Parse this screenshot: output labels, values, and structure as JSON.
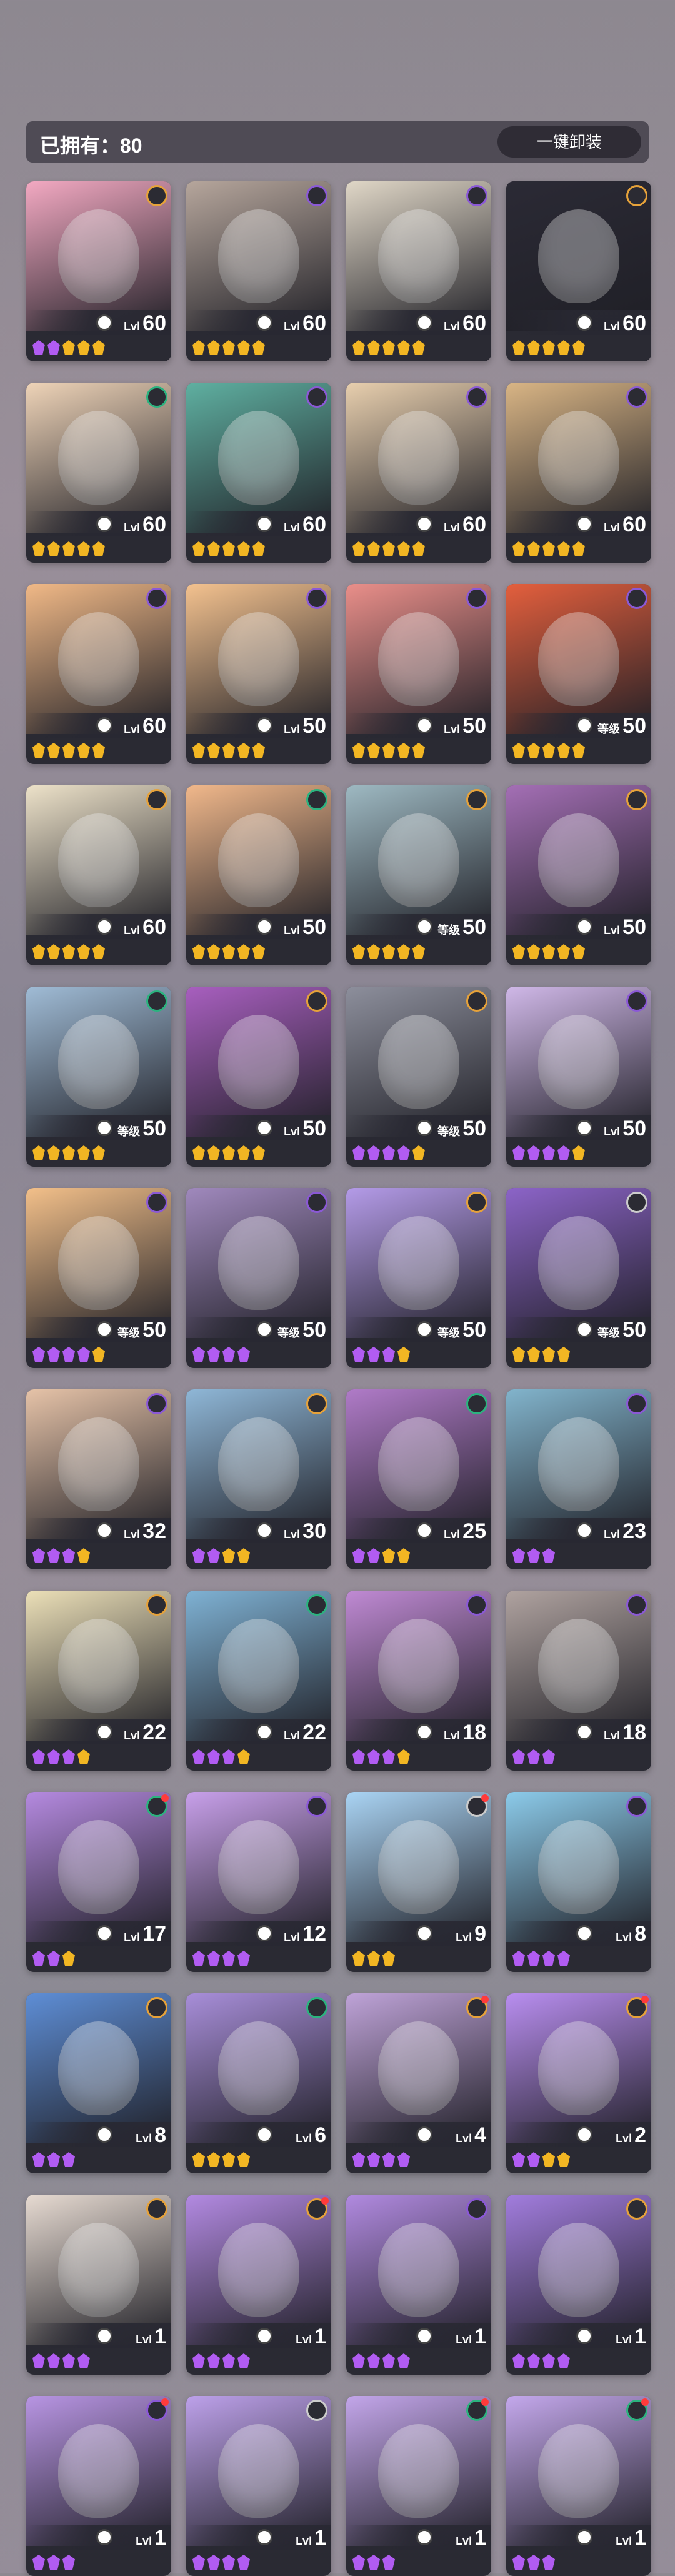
{
  "header": {
    "owned_label": "已拥有：80",
    "unequip_all_label": "一键卸装"
  },
  "colors": {
    "gold": "#f2b623",
    "purple": "#b15cf2",
    "faction_orange": "#e6a23a",
    "faction_purple": "#8b59d6",
    "faction_green": "#2bb37f",
    "faction_white": "#cccccc"
  },
  "cards": [
    {
      "level": "60",
      "level_label": "Lvl",
      "gems": "ppggg",
      "faction": "orange",
      "bg": "#f3a9c2"
    },
    {
      "level": "60",
      "level_label": "Lvl",
      "gems": "ggggg",
      "faction": "purple",
      "bg": "#b6a69c"
    },
    {
      "level": "60",
      "level_label": "Lvl",
      "gems": "ggggg",
      "faction": "purple",
      "bg": "#e0d7c7"
    },
    {
      "level": "60",
      "level_label": "Lvl",
      "gems": "ggggg",
      "faction": "orange",
      "bg": "#2b2a35"
    },
    {
      "level": "60",
      "level_label": "Lvl",
      "gems": "ggggg",
      "faction": "green",
      "bg": "#efd4b8"
    },
    {
      "level": "60",
      "level_label": "Lvl",
      "gems": "ggggg",
      "faction": "purple",
      "bg": "#5fb0a1"
    },
    {
      "level": "60",
      "level_label": "Lvl",
      "gems": "ggggg",
      "faction": "purple",
      "bg": "#e8cfae"
    },
    {
      "level": "60",
      "level_label": "Lvl",
      "gems": "ggggg",
      "faction": "purple",
      "bg": "#d9b585"
    },
    {
      "level": "60",
      "level_label": "Lvl",
      "gems": "ggggg",
      "faction": "purple",
      "bg": "#f1b987"
    },
    {
      "level": "50",
      "level_label": "Lvl",
      "gems": "ggggg",
      "faction": "purple",
      "bg": "#f4c28f"
    },
    {
      "level": "50",
      "level_label": "Lvl",
      "gems": "ggggg",
      "faction": "purple",
      "bg": "#ea8f8a"
    },
    {
      "level": "50",
      "level_label": "等级",
      "gems": "ggggg",
      "faction": "purple",
      "bg": "#e45f3d"
    },
    {
      "level": "60",
      "level_label": "Lvl",
      "gems": "ggggg",
      "faction": "orange",
      "bg": "#ede2c9"
    },
    {
      "level": "50",
      "level_label": "Lvl",
      "gems": "ggggg",
      "faction": "green",
      "bg": "#f1b88b"
    },
    {
      "level": "50",
      "level_label": "等级",
      "gems": "ggggg",
      "faction": "orange",
      "bg": "#9eb9c2"
    },
    {
      "level": "50",
      "level_label": "Lvl",
      "gems": "ggggg",
      "faction": "orange",
      "bg": "#a46fb5"
    },
    {
      "level": "50",
      "level_label": "等级",
      "gems": "ggggg",
      "faction": "green",
      "bg": "#a0bcd6"
    },
    {
      "level": "50",
      "level_label": "Lvl",
      "gems": "ggggg",
      "faction": "orange",
      "bg": "#a85fbf"
    },
    {
      "level": "50",
      "level_label": "等级",
      "gems": "ppppg",
      "faction": "orange",
      "bg": "#8d8f9c"
    },
    {
      "level": "50",
      "level_label": "Lvl",
      "gems": "ppppg",
      "faction": "purple",
      "bg": "#d0b8e8"
    },
    {
      "level": "50",
      "level_label": "等级",
      "gems": "ppppg",
      "faction": "purple",
      "bg": "#f3c08a"
    },
    {
      "level": "50",
      "level_label": "等级",
      "gems": "pppp",
      "faction": "purple",
      "bg": "#a089bd"
    },
    {
      "level": "50",
      "level_label": "等级",
      "gems": "pppg",
      "faction": "orange",
      "bg": "#b49be8"
    },
    {
      "level": "50",
      "level_label": "等级",
      "gems": "gggg",
      "faction": "white",
      "bg": "#8c64c8"
    },
    {
      "level": "32",
      "level_label": "Lvl",
      "gems": "pppg",
      "faction": "purple",
      "bg": "#e6c3a8"
    },
    {
      "level": "30",
      "level_label": "Lvl",
      "gems": "ppgg",
      "faction": "orange",
      "bg": "#8fb7d7"
    },
    {
      "level": "25",
      "level_label": "Lvl",
      "gems": "ppgg",
      "faction": "green",
      "bg": "#b07bc8"
    },
    {
      "level": "23",
      "level_label": "Lvl",
      "gems": "ppp",
      "faction": "purple",
      "bg": "#82b4cc"
    },
    {
      "level": "22",
      "level_label": "Lvl",
      "gems": "pppg",
      "faction": "orange",
      "bg": "#ece0b8"
    },
    {
      "level": "22",
      "level_label": "Lvl",
      "gems": "pppg",
      "faction": "green",
      "bg": "#7fb2d4"
    },
    {
      "level": "18",
      "level_label": "Lvl",
      "gems": "pppg",
      "faction": "purple",
      "bg": "#c08ad4"
    },
    {
      "level": "18",
      "level_label": "Lvl",
      "gems": "ppp",
      "faction": "purple",
      "bg": "#b0a3a0"
    },
    {
      "level": "17",
      "level_label": "Lvl",
      "gems": "ppg",
      "faction": "green",
      "dot": true,
      "bg": "#b58ae0"
    },
    {
      "level": "12",
      "level_label": "Lvl",
      "gems": "pppp",
      "faction": "purple",
      "bg": "#c8a0ea"
    },
    {
      "level": "9",
      "level_label": "Lvl",
      "gems": "ggg",
      "faction": "white",
      "dot": true,
      "bg": "#aad4f4"
    },
    {
      "level": "8",
      "level_label": "Lvl",
      "gems": "pppp",
      "faction": "purple",
      "bg": "#8ccbea"
    },
    {
      "level": "8",
      "level_label": "Lvl",
      "gems": "ppp",
      "faction": "orange",
      "bg": "#5e8ed6"
    },
    {
      "level": "6",
      "level_label": "Lvl",
      "gems": "gggg",
      "faction": "green",
      "bg": "#a88ed9"
    },
    {
      "level": "4",
      "level_label": "Lvl",
      "gems": "pppp",
      "faction": "orange",
      "dot": true,
      "bg": "#bfa3d8"
    },
    {
      "level": "2",
      "level_label": "Lvl",
      "gems": "ppgg",
      "faction": "orange",
      "dot": true,
      "bg": "#b98ef0"
    },
    {
      "level": "1",
      "level_label": "Lvl",
      "gems": "pppp",
      "faction": "orange",
      "bg": "#e7dbd2"
    },
    {
      "level": "1",
      "level_label": "Lvl",
      "gems": "pppp",
      "faction": "orange",
      "dot": true,
      "bg": "#b38ae2"
    },
    {
      "level": "1",
      "level_label": "Lvl",
      "gems": "pppp",
      "faction": "purple",
      "bg": "#b18ae0"
    },
    {
      "level": "1",
      "level_label": "Lvl",
      "gems": "pppp",
      "faction": "orange",
      "bg": "#a27dde"
    },
    {
      "level": "1",
      "level_label": "Lvl",
      "gems": "ppp",
      "faction": "purple",
      "dot": true,
      "bg": "#b895e3"
    },
    {
      "level": "1",
      "level_label": "Lvl",
      "gems": "pppp",
      "faction": "white",
      "bg": "#bda1ea"
    },
    {
      "level": "1",
      "level_label": "Lvl",
      "gems": "ppp",
      "faction": "green",
      "dot": true,
      "bg": "#c3a6ea"
    },
    {
      "level": "1",
      "level_label": "Lvl",
      "gems": "ppp",
      "faction": "green",
      "dot": true,
      "bg": "#c4a8ec"
    }
  ]
}
